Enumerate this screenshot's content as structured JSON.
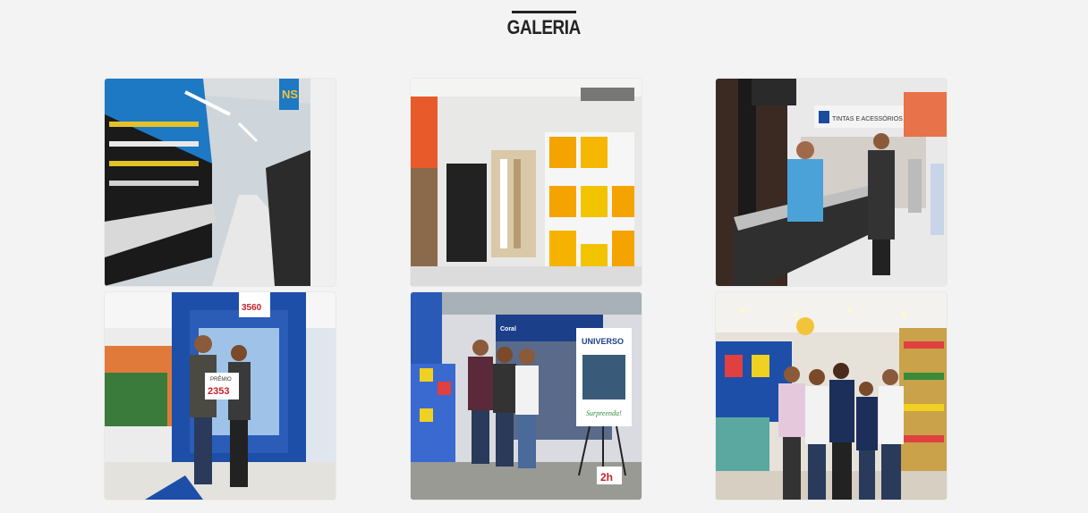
{
  "gallery": {
    "title": "GALERIA",
    "photos": [
      {
        "subject": "store aisle with tool shelves",
        "sign": "NS"
      },
      {
        "subject": "paint and tile display shelves"
      },
      {
        "subject": "checkout counter with customers",
        "sign": "TINTAS E ACESSÓRIOS"
      },
      {
        "subject": "prize winners holding ticket",
        "ticket_label": "PRÊMIO",
        "ticket_number": "2353",
        "banner_number": "3560"
      },
      {
        "subject": "team in front of Coral paint display",
        "banner_brand": "UNIVERSO",
        "banner_tagline": "Surpreenda!",
        "easel_label": "2h",
        "shelf_brand": "Coral"
      },
      {
        "subject": "group photo in supermarket aisle"
      }
    ]
  },
  "colors": {
    "background": "#f3f3f3",
    "title": "#222222"
  }
}
